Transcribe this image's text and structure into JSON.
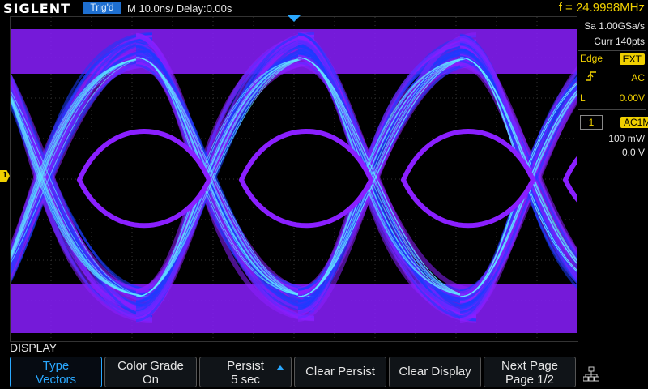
{
  "header": {
    "brand": "SIGLENT",
    "trigger_status": "Trig'd",
    "timebase": "M 10.0ns/",
    "delay": "Delay:0.00s",
    "frequency": "f = 24.9998MHz"
  },
  "acquisition": {
    "sample_rate": "Sa 1.00GSa/s",
    "memory": "Curr 140pts"
  },
  "trigger": {
    "type": "Edge",
    "source": "EXT",
    "coupling": "AC",
    "level_label": "L",
    "level": "0.00V"
  },
  "channel1": {
    "number": "1",
    "coupling": "AC1M",
    "scale": "100 mV/",
    "offset": "0.0 V"
  },
  "markers": {
    "channel_marker": "1"
  },
  "menu": {
    "title": "DISPLAY",
    "softkeys": [
      {
        "line1": "Type",
        "line2": "Vectors"
      },
      {
        "line1": "Color Grade",
        "line2": "On"
      },
      {
        "line1": "Persist",
        "line2": "5 sec"
      },
      {
        "line1": "Clear Persist",
        "line2": ""
      },
      {
        "line1": "Clear Display",
        "line2": ""
      },
      {
        "line1": "Next Page",
        "line2": "Page 1/2"
      }
    ]
  },
  "icons": {
    "network": "network-icon",
    "trigger_edge": "rising-edge-icon"
  },
  "colors": {
    "accent": "#2aa8ff",
    "trace_blue": "#1a3cff",
    "trace_purple": "#8a1fff",
    "highlight": "#f0d000"
  }
}
